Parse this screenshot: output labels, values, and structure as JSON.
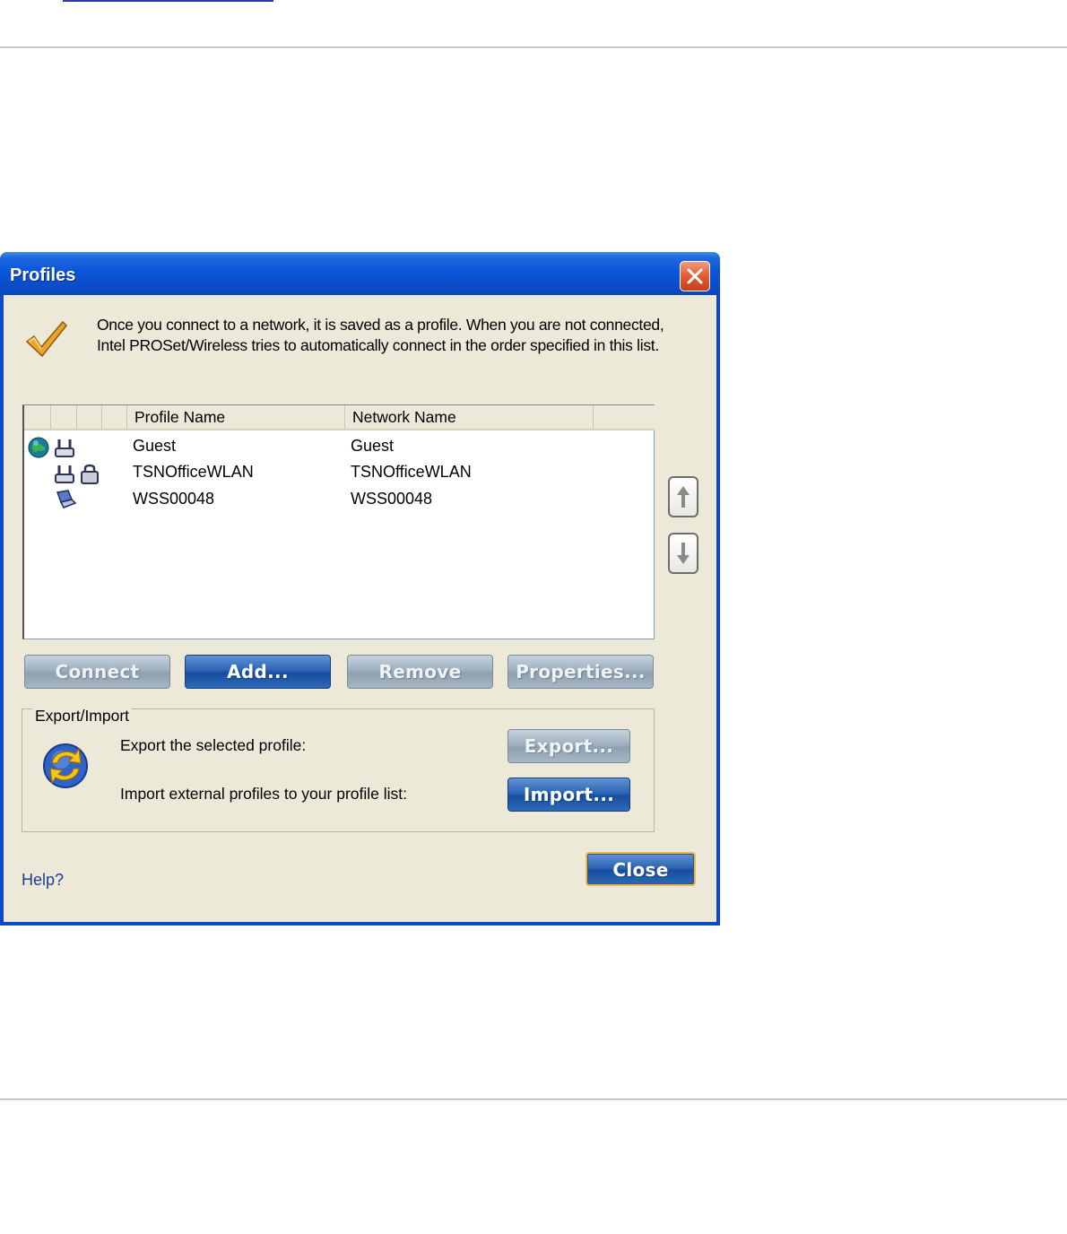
{
  "window": {
    "title": "Profiles"
  },
  "intro_text": "Once you connect to a network, it is saved as a profile. When you are not connected, Intel PROSet/Wireless tries to automatically connect in the order specified in this list.",
  "list": {
    "columns": [
      "Profile Name",
      "Network Name"
    ],
    "rows": [
      {
        "profile": "Guest",
        "network": "Guest",
        "icons": [
          "globe-icon",
          "router-icon"
        ]
      },
      {
        "profile": "TSNOfficeWLAN",
        "network": "TSNOfficeWLAN",
        "icons": [
          "router-icon",
          "lock-icon"
        ]
      },
      {
        "profile": "WSS00048",
        "network": "WSS00048",
        "icons": [
          "laptop-icon"
        ]
      }
    ]
  },
  "buttons": {
    "connect": "Connect",
    "add": "Add...",
    "remove": "Remove",
    "properties": "Properties...",
    "export": "Export...",
    "import": "Import...",
    "close": "Close"
  },
  "export_import": {
    "legend": "Export/Import",
    "export_label": "Export the selected profile:",
    "import_label": "Import external profiles to your profile list:"
  },
  "help_link": "Help?",
  "colors": {
    "titlebar": "#0a55d8",
    "client_bg": "#ece9d8",
    "blue_button": "#2e65b4",
    "gray_button": "#9eb0c0",
    "close_accent": "#e9b94c"
  }
}
